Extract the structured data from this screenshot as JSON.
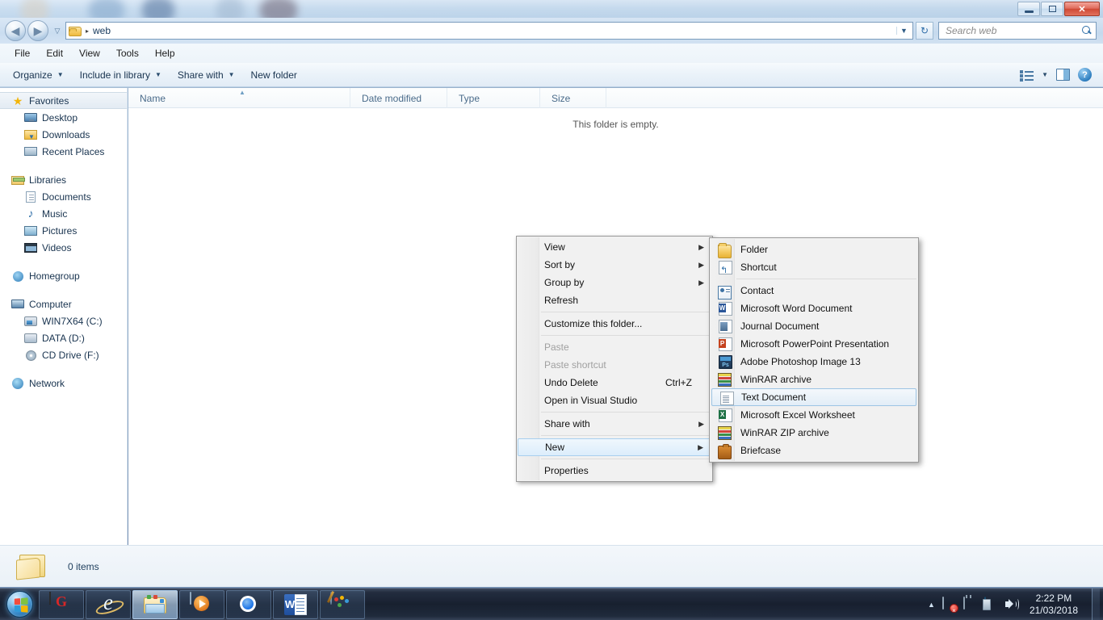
{
  "window": {
    "controls": {
      "minimize": "minimize-button",
      "maximize": "maximize-button",
      "close": "close-button"
    }
  },
  "address": {
    "folder_icon": "folder-icon",
    "separator": "▸",
    "crumb": "web",
    "dropdown": "▼",
    "refresh_glyph": "↻",
    "back_glyph": "◀",
    "forward_glyph": "▶",
    "history_glyph": "▽"
  },
  "search": {
    "placeholder": "Search web",
    "value": "",
    "icon": "search-icon"
  },
  "menubar": {
    "items": [
      "File",
      "Edit",
      "View",
      "Tools",
      "Help"
    ]
  },
  "commandbar": {
    "organize": "Organize",
    "include_in_library": "Include in library",
    "share_with": "Share with",
    "new_folder": "New folder",
    "caret": "▼",
    "view_icon": "view-layout-icon",
    "preview_pane_icon": "preview-pane-icon",
    "help_icon": "help-icon",
    "help_glyph": "?"
  },
  "navpane": {
    "groups": [
      {
        "header": {
          "label": "Favorites",
          "icon": "star-icon",
          "selected": true
        },
        "children": [
          {
            "label": "Desktop",
            "icon": "desktop-icon"
          },
          {
            "label": "Downloads",
            "icon": "downloads-icon"
          },
          {
            "label": "Recent Places",
            "icon": "recent-places-icon"
          }
        ]
      },
      {
        "header": {
          "label": "Libraries",
          "icon": "libraries-icon",
          "selected": false
        },
        "children": [
          {
            "label": "Documents",
            "icon": "documents-icon"
          },
          {
            "label": "Music",
            "icon": "music-icon"
          },
          {
            "label": "Pictures",
            "icon": "pictures-icon"
          },
          {
            "label": "Videos",
            "icon": "videos-icon"
          }
        ]
      },
      {
        "header": {
          "label": "Homegroup",
          "icon": "homegroup-icon",
          "selected": false
        },
        "children": []
      },
      {
        "header": {
          "label": "Computer",
          "icon": "computer-icon",
          "selected": false
        },
        "children": [
          {
            "label": "WIN7X64 (C:)",
            "icon": "system-drive-icon"
          },
          {
            "label": "DATA (D:)",
            "icon": "drive-icon"
          },
          {
            "label": "CD Drive (F:)",
            "icon": "cd-drive-icon"
          }
        ]
      },
      {
        "header": {
          "label": "Network",
          "icon": "network-icon",
          "selected": false
        },
        "children": []
      }
    ]
  },
  "filelist": {
    "columns": [
      {
        "label": "Name",
        "sorted": true,
        "sort_glyph": "▲"
      },
      {
        "label": "Date modified",
        "sorted": false
      },
      {
        "label": "Type",
        "sorted": false
      },
      {
        "label": "Size",
        "sorted": false
      }
    ],
    "empty_message": "This folder is empty."
  },
  "statusbar": {
    "item_count": "0 items",
    "folder_icon": "folder-icon"
  },
  "context_menu": {
    "items": [
      {
        "label": "View",
        "submenu": true,
        "disabled": false,
        "accel": ""
      },
      {
        "label": "Sort by",
        "submenu": true,
        "disabled": false,
        "accel": ""
      },
      {
        "label": "Group by",
        "submenu": true,
        "disabled": false,
        "accel": ""
      },
      {
        "label": "Refresh",
        "submenu": false,
        "disabled": false,
        "accel": ""
      },
      {
        "separator": true
      },
      {
        "label": "Customize this folder...",
        "submenu": false,
        "disabled": false,
        "accel": ""
      },
      {
        "separator": true
      },
      {
        "label": "Paste",
        "submenu": false,
        "disabled": true,
        "accel": ""
      },
      {
        "label": "Paste shortcut",
        "submenu": false,
        "disabled": true,
        "accel": ""
      },
      {
        "label": "Undo Delete",
        "submenu": false,
        "disabled": false,
        "accel": "Ctrl+Z"
      },
      {
        "label": "Open in Visual Studio",
        "submenu": false,
        "disabled": false,
        "accel": ""
      },
      {
        "separator": true
      },
      {
        "label": "Share with",
        "submenu": true,
        "disabled": false,
        "accel": ""
      },
      {
        "separator": true
      },
      {
        "label": "New",
        "submenu": true,
        "disabled": false,
        "accel": "",
        "highlighted": true
      },
      {
        "separator": true
      },
      {
        "label": "Properties",
        "submenu": false,
        "disabled": false,
        "accel": ""
      }
    ],
    "arrow_glyph": "▶"
  },
  "new_submenu": {
    "items": [
      {
        "label": "Folder",
        "icon": "folder-icon",
        "highlighted": false
      },
      {
        "label": "Shortcut",
        "icon": "shortcut-icon",
        "highlighted": false
      },
      {
        "separator": true
      },
      {
        "label": "Contact",
        "icon": "contact-icon",
        "highlighted": false
      },
      {
        "label": "Microsoft Word Document",
        "icon": "word-document-icon",
        "highlighted": false
      },
      {
        "label": "Journal Document",
        "icon": "journal-document-icon",
        "highlighted": false
      },
      {
        "label": "Microsoft PowerPoint Presentation",
        "icon": "powerpoint-icon",
        "highlighted": false
      },
      {
        "label": "Adobe Photoshop Image 13",
        "icon": "photoshop-icon",
        "highlighted": false
      },
      {
        "label": "WinRAR archive",
        "icon": "winrar-icon",
        "highlighted": false
      },
      {
        "label": "Text Document",
        "icon": "text-document-icon",
        "highlighted": true
      },
      {
        "label": "Microsoft Excel Worksheet",
        "icon": "excel-icon",
        "highlighted": false
      },
      {
        "label": "WinRAR ZIP archive",
        "icon": "winrar-zip-icon",
        "highlighted": false
      },
      {
        "label": "Briefcase",
        "icon": "briefcase-icon",
        "highlighted": false
      }
    ]
  },
  "taskbar": {
    "start": {
      "name": "start-orb"
    },
    "buttons": [
      {
        "name": "garena-icon",
        "state": "pinned"
      },
      {
        "name": "internet-explorer-icon",
        "state": "pinned"
      },
      {
        "name": "windows-explorer-icon",
        "state": "active"
      },
      {
        "name": "windows-media-player-icon",
        "state": "pinned"
      },
      {
        "name": "google-chrome-icon",
        "state": "pinned"
      },
      {
        "name": "microsoft-word-icon",
        "state": "pinned"
      },
      {
        "name": "paint-icon",
        "state": "pinned"
      }
    ],
    "tray": {
      "show_hidden_glyph": "▲",
      "icons": [
        "action-center-icon",
        "safely-remove-hardware-icon",
        "network-icon",
        "volume-icon"
      ],
      "time": "2:22 PM",
      "date": "21/03/2018"
    }
  },
  "colors": {
    "accent": "#2f7fc0",
    "highlight": "#dcedfb",
    "highlight_border": "#a8cfee",
    "taskbar": "#16202d",
    "window_chrome": "#cde0f3"
  }
}
